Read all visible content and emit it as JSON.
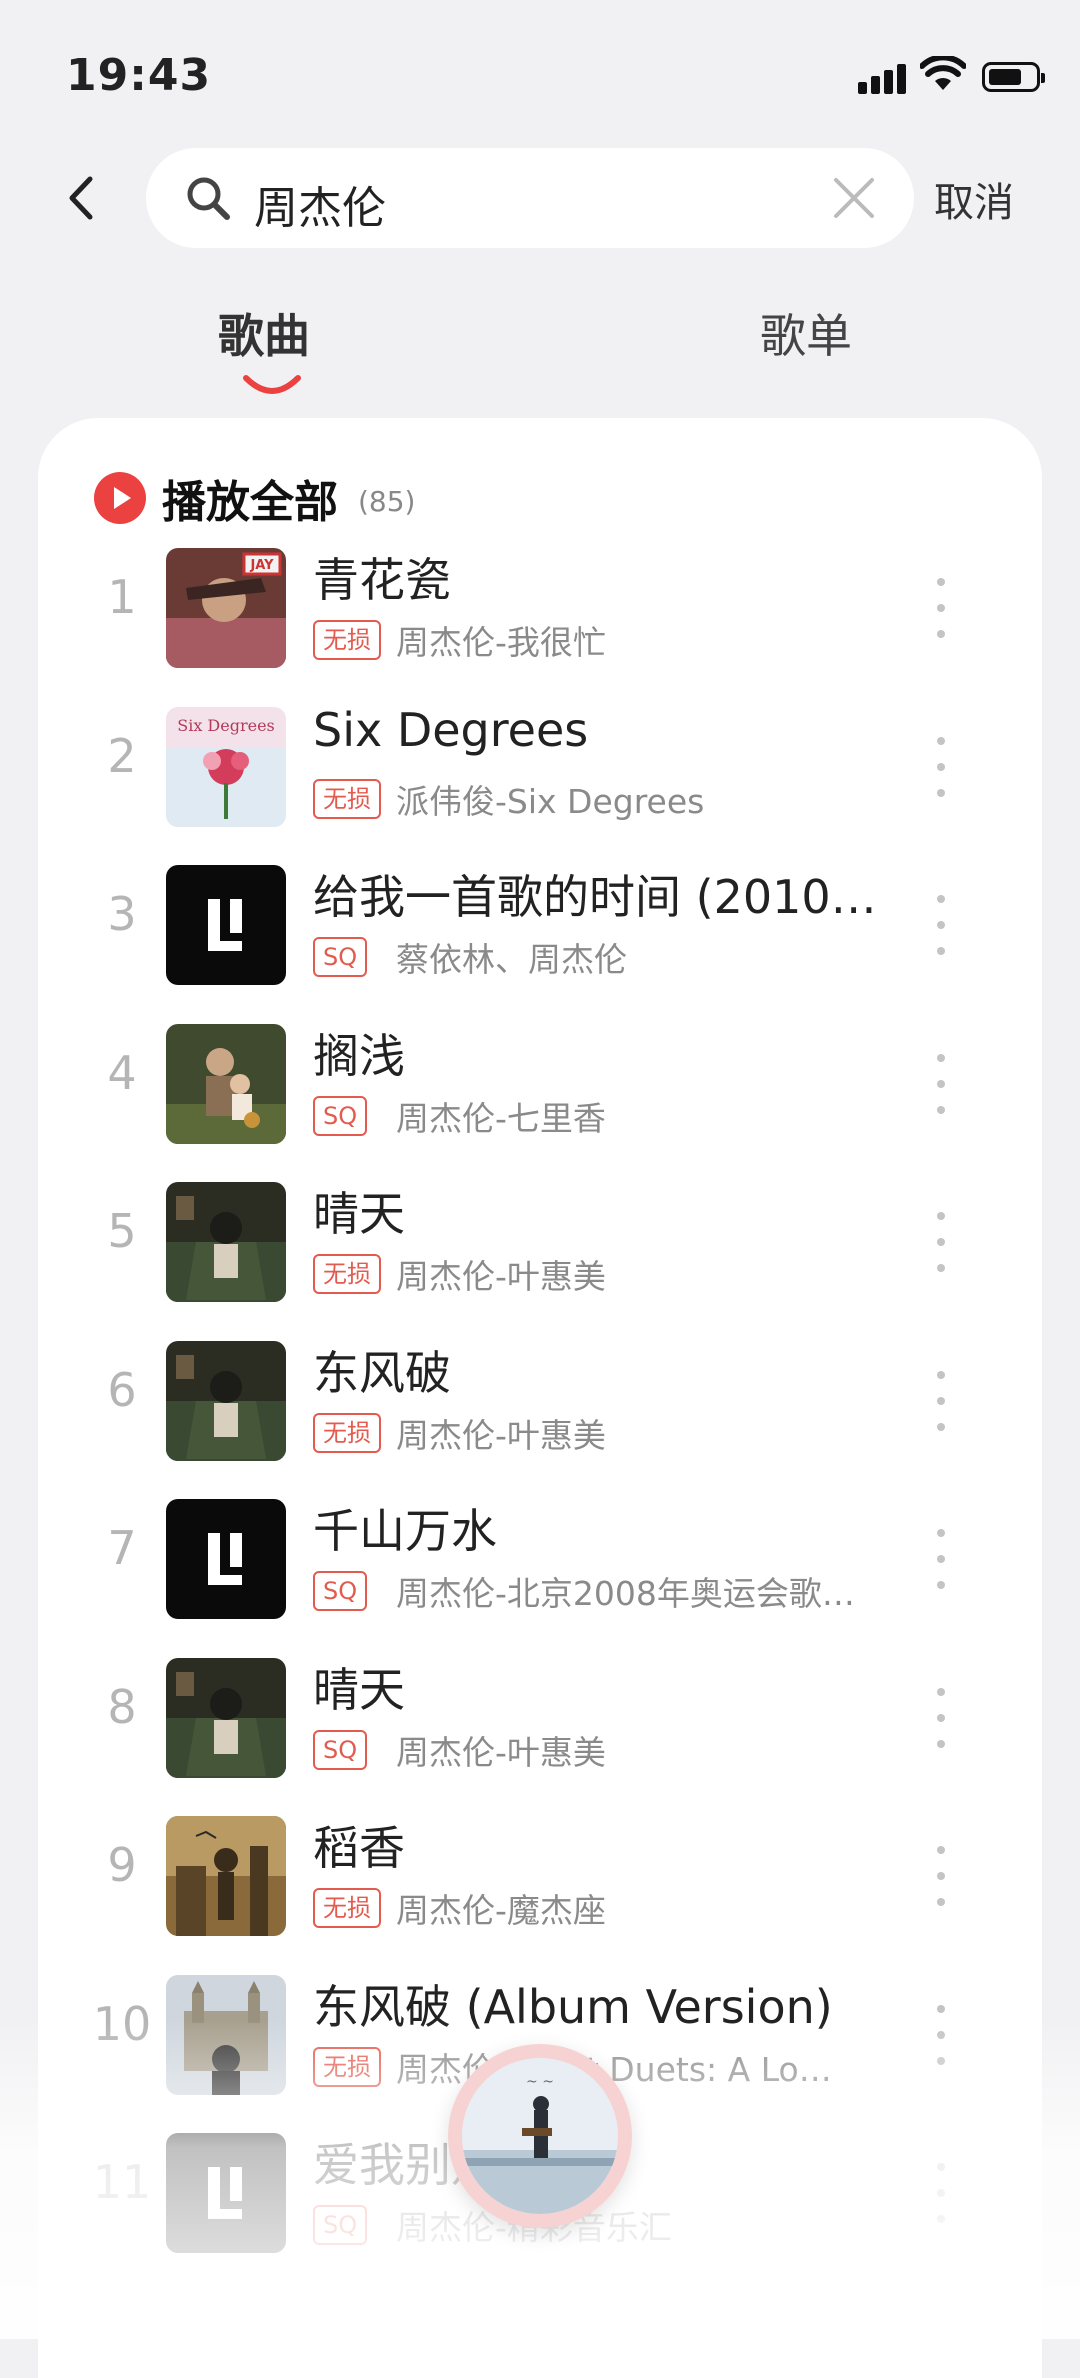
{
  "status_bar": {
    "time": "19:43"
  },
  "search": {
    "query": "周杰伦",
    "cancel_label": "取消"
  },
  "tabs": [
    {
      "label": "歌曲",
      "active": true
    },
    {
      "label": "歌单",
      "active": false
    }
  ],
  "list": {
    "play_all_label": "播放全部",
    "count": "(85)",
    "songs": [
      {
        "index": "1",
        "title": "青花瓷",
        "tag": "无损",
        "subtitle": "周杰伦-我很忙",
        "cover": "album-jay-cowboy"
      },
      {
        "index": "2",
        "title": "Six Degrees",
        "tag": "无损",
        "subtitle": "派伟俊-Six Degrees",
        "cover": "album-six-degrees"
      },
      {
        "index": "3",
        "title": "给我一首歌的时间 (2010…",
        "tag": "SQ",
        "subtitle": "蔡依林、周杰伦",
        "cover": "logo-black"
      },
      {
        "index": "4",
        "title": "搁浅",
        "tag": "SQ",
        "subtitle": "周杰伦-七里香",
        "cover": "album-qilixiang"
      },
      {
        "index": "5",
        "title": "晴天",
        "tag": "无损",
        "subtitle": "周杰伦-叶惠美",
        "cover": "album-yehuimei"
      },
      {
        "index": "6",
        "title": "东风破",
        "tag": "无损",
        "subtitle": "周杰伦-叶惠美",
        "cover": "album-yehuimei"
      },
      {
        "index": "7",
        "title": "千山万水",
        "tag": "SQ",
        "subtitle": "周杰伦-北京2008年奥运会歌…",
        "cover": "logo-black"
      },
      {
        "index": "8",
        "title": "晴天",
        "tag": "SQ",
        "subtitle": "周杰伦-叶惠美",
        "cover": "album-yehuimei"
      },
      {
        "index": "9",
        "title": "稻香",
        "tag": "无损",
        "subtitle": "周杰伦-魔杰座",
        "cover": "album-mojiezuo"
      },
      {
        "index": "10",
        "title": "东风破 (Album Version)",
        "tag": "无损",
        "subtitle": "周杰伦-Great Duets: A Lo…",
        "cover": "album-castle"
      },
      {
        "index": "11",
        "title": "爱我别走",
        "tag": "SQ",
        "subtitle": "周杰伦-精彩音乐汇",
        "cover": "logo-black"
      }
    ]
  },
  "colors": {
    "accent": "#ec4141",
    "tag": "#e35b4f",
    "background": "#f1f1f3"
  }
}
